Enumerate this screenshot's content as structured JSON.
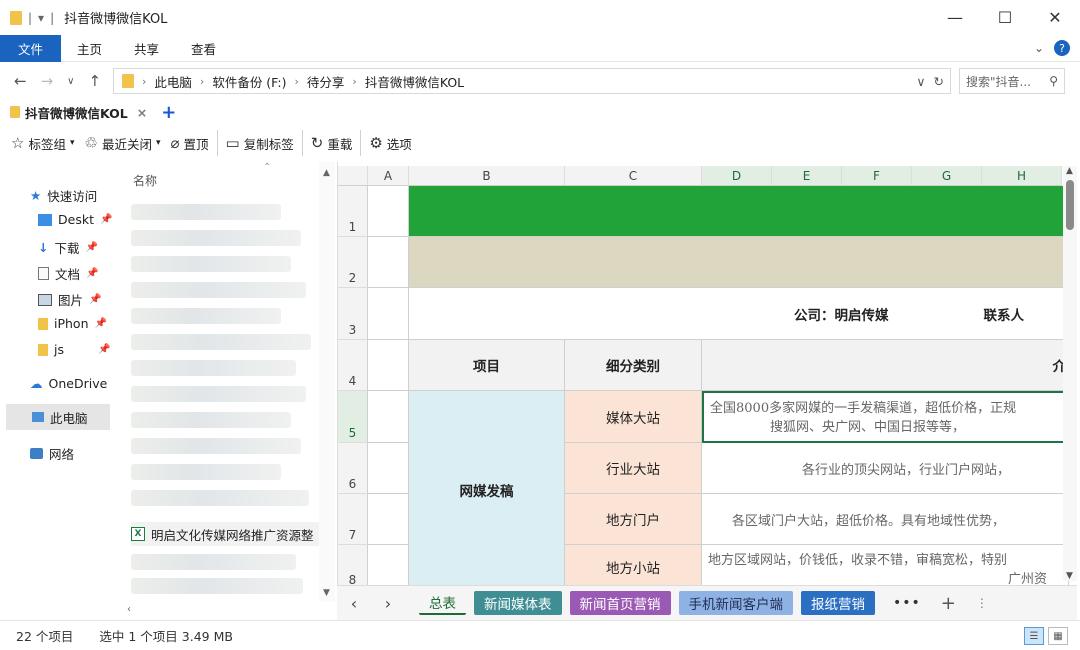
{
  "window": {
    "title": "抖音微博微信KOL",
    "controls": [
      "—",
      "☐",
      "✕"
    ]
  },
  "ribbon": {
    "tabs": [
      "文件",
      "主页",
      "共享",
      "查看"
    ]
  },
  "address": {
    "segments": [
      "此电脑",
      "软件备份 (F:)",
      "待分享",
      "抖音微博微信KOL"
    ],
    "search_placeholder": "搜索\"抖音...",
    "refresh": "↻"
  },
  "tabstrip": {
    "tab_label": "抖音微博微信KOL",
    "close": "×",
    "add": "+"
  },
  "toolbar": {
    "bookmarks": "标签组",
    "recent_closed": "最近关闭",
    "pin_top": "置顶",
    "copy_tab": "复制标签",
    "reload": "重载",
    "options": "选项"
  },
  "nav_pane": {
    "quick_access": "快速访问",
    "items": [
      {
        "label": "Deskt",
        "icon": "desktop-icon"
      },
      {
        "label": "下载",
        "icon": "download-icon"
      },
      {
        "label": "文档",
        "icon": "document-icon"
      },
      {
        "label": "图片",
        "icon": "picture-icon"
      },
      {
        "label": "iPhon",
        "icon": "folder-icon"
      },
      {
        "label": "js",
        "icon": "folder-icon"
      }
    ],
    "onedrive": "OneDrive",
    "this_pc": "此电脑",
    "network": "网络"
  },
  "file_list": {
    "column_name": "名称",
    "selected_file": "明启文化传媒网络推广资源整"
  },
  "sheet": {
    "columns": [
      "A",
      "B",
      "C",
      "D",
      "E",
      "F",
      "G",
      "H"
    ],
    "rows": [
      "1",
      "2",
      "3",
      "4",
      "5",
      "6",
      "7",
      "8"
    ],
    "company": "公司：明启传媒",
    "contact": "联系人",
    "header_item": "项目",
    "header_category": "细分类别",
    "header_intro": "介",
    "group_label": "网媒发稿",
    "categories": [
      "媒体大站",
      "行业大站",
      "地方门户",
      "地方小站"
    ],
    "descriptions": [
      "全国8000多家网媒的一手发稿渠道，超低价格，正规",
      "搜狐网、央广网、中国日报等等，",
      "各行业的顶尖网站，行业门户网站，",
      "各区域门户大站，超低价格。具有地域性优势，",
      "地方区域网站，价钱低，收录不错，审稿宽松，特别",
      "广州资"
    ]
  },
  "sheet_tabs": [
    {
      "label": "总表",
      "bg": "#f5f5f5",
      "fg": "#1f6b37"
    },
    {
      "label": "新闻媒体表",
      "bg": "#3f8e93",
      "fg": "#ffffff"
    },
    {
      "label": "新闻首页营销",
      "bg": "#9b59b6",
      "fg": "#ffffff"
    },
    {
      "label": "手机新闻客户端",
      "bg": "#8fb2e4",
      "fg": "#1f2f55"
    },
    {
      "label": "报纸营销",
      "bg": "#2a6fc2",
      "fg": "#ffffff"
    }
  ],
  "status": {
    "count": "22 个项目",
    "selection": "选中 1 个项目  3.49 MB"
  },
  "colors": {
    "accent": "#1a63bf",
    "title_band": "#22a33a",
    "band2": "#dcd7c0",
    "group_fill": "#dbeef4",
    "category_fill": "#fbe4d6"
  }
}
